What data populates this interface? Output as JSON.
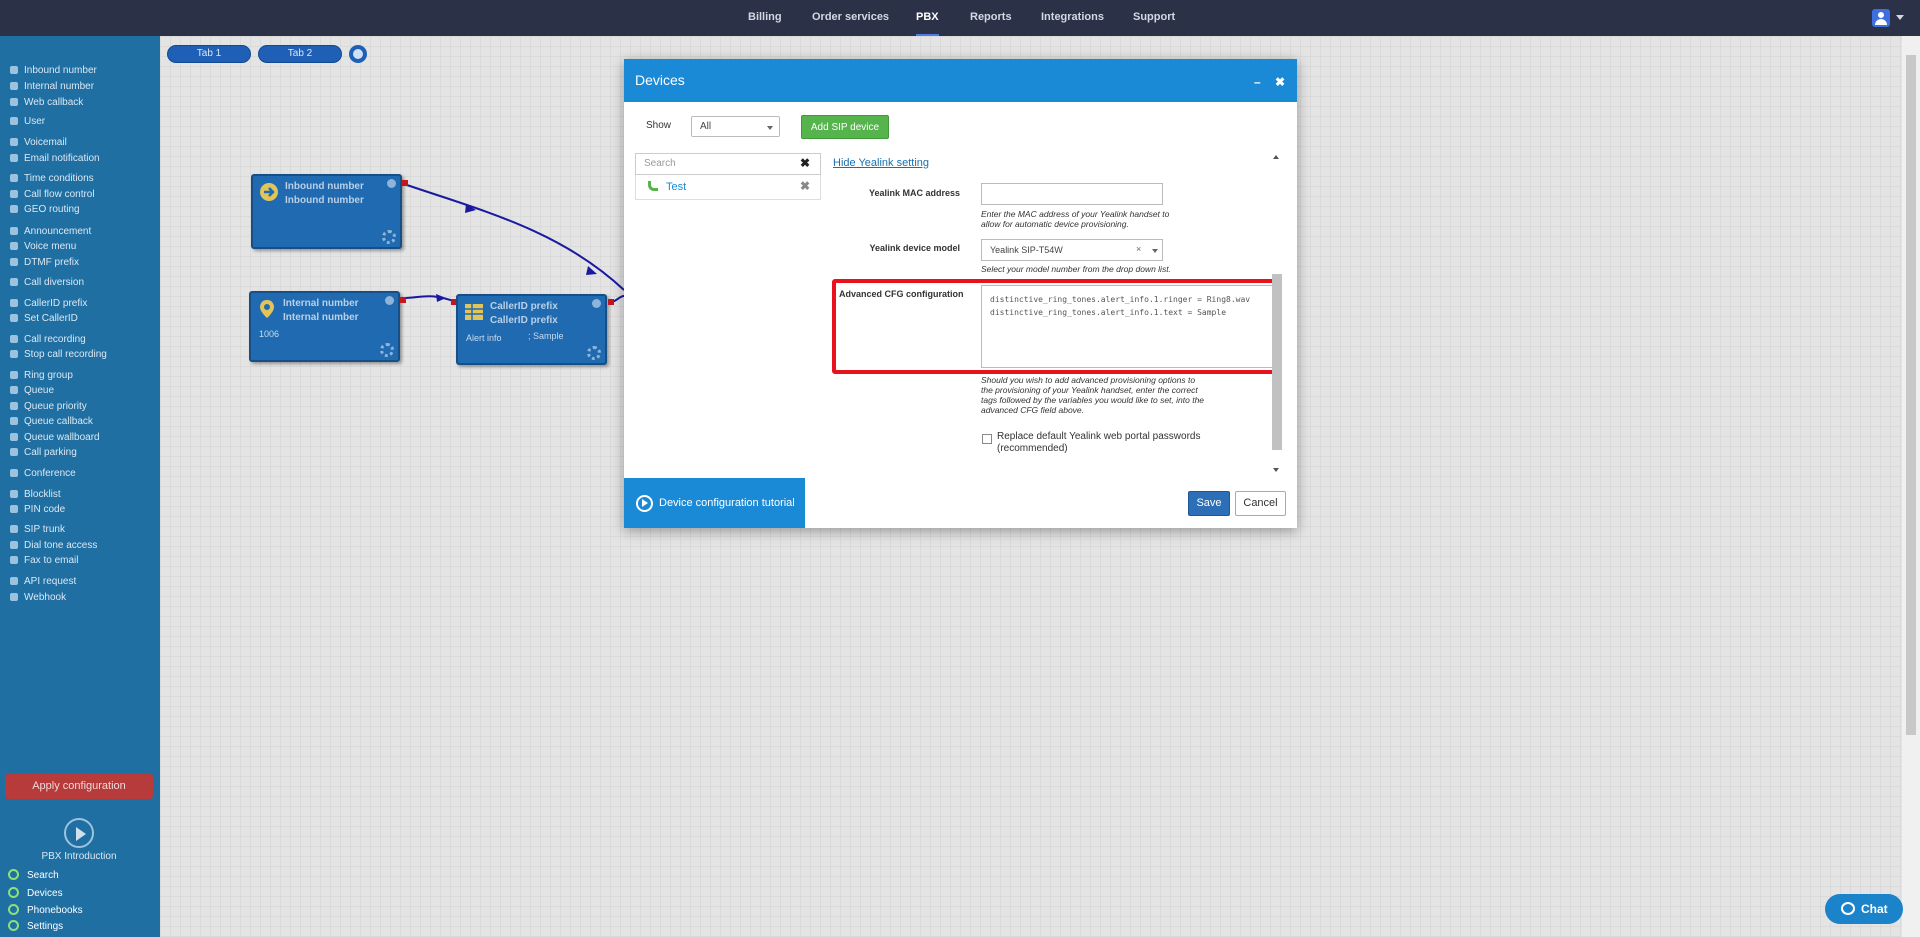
{
  "topnav": {
    "items": [
      "Billing",
      "Order services",
      "PBX",
      "Reports",
      "Integrations",
      "Support"
    ],
    "active": "PBX"
  },
  "sidebar": {
    "items": [
      "Inbound number",
      "Internal number",
      "Web callback",
      "User",
      "Voicemail",
      "Email notification",
      "Time conditions",
      "Call flow control",
      "GEO routing",
      "Announcement",
      "Voice menu",
      "DTMF prefix",
      "Call diversion",
      "CallerID prefix",
      "Set CallerID",
      "Call recording",
      "Stop call recording",
      "Ring group",
      "Queue",
      "Queue priority",
      "Queue callback",
      "Queue wallboard",
      "Call parking",
      "Conference",
      "Blocklist",
      "PIN code",
      "SIP trunk",
      "Dial tone access",
      "Fax to email",
      "API request",
      "Webhook"
    ],
    "apply_label": "Apply configuration",
    "intro_label": "PBX Introduction",
    "bottom": [
      "Search",
      "Devices",
      "Phonebooks",
      "Settings"
    ]
  },
  "tabs": [
    "Tab 1",
    "Tab 2"
  ],
  "nodes": {
    "inbound": {
      "title1": "Inbound number",
      "title2": "Inbound number"
    },
    "internal": {
      "title1": "Internal number",
      "title2": "Internal number",
      "sub": "1006"
    },
    "callerid": {
      "title1": "CallerID prefix",
      "title2": "CallerID prefix",
      "sub1": "Alert info",
      "sub2": "; Sample"
    }
  },
  "modal": {
    "title": "Devices",
    "minimize": "–",
    "close": "✖",
    "show_label": "Show",
    "show_value": "All",
    "add_sip_label": "Add SIP device",
    "search_placeholder": "Search",
    "devices": [
      "Test"
    ],
    "hide_link": "Hide Yealink setting",
    "mac_label": "Yealink MAC address",
    "mac_value": "",
    "mac_hint": "Enter the MAC address of your Yealink handset to allow for automatic device provisioning.",
    "model_label": "Yealink device model",
    "model_value": "Yealink SIP-T54W",
    "model_hint": "Select your model number from the drop down list.",
    "cfg_label": "Advanced CFG configuration",
    "cfg_value": "distinctive_ring_tones.alert_info.1.ringer = Ring8.wav\ndistinctive_ring_tones.alert_info.1.text = Sample",
    "cfg_hint": "Should you wish to add advanced provisioning options to the provisioning of your Yealink handset, enter the correct tags followed by the variables you would like to set, into the advanced CFG field above.",
    "replace_label": "Replace default Yealink web portal passwords (recommended)",
    "replace_checked": false,
    "tutorial_label": "Device configuration tutorial",
    "save_label": "Save",
    "cancel_label": "Cancel"
  },
  "chat_label": "Chat",
  "colors": {
    "topnav": "#2b3248",
    "sidebar": "#1f6fa3",
    "modal_header": "#1b8ad6",
    "highlight": "#e8121c",
    "add_sip": "#55b44b"
  }
}
